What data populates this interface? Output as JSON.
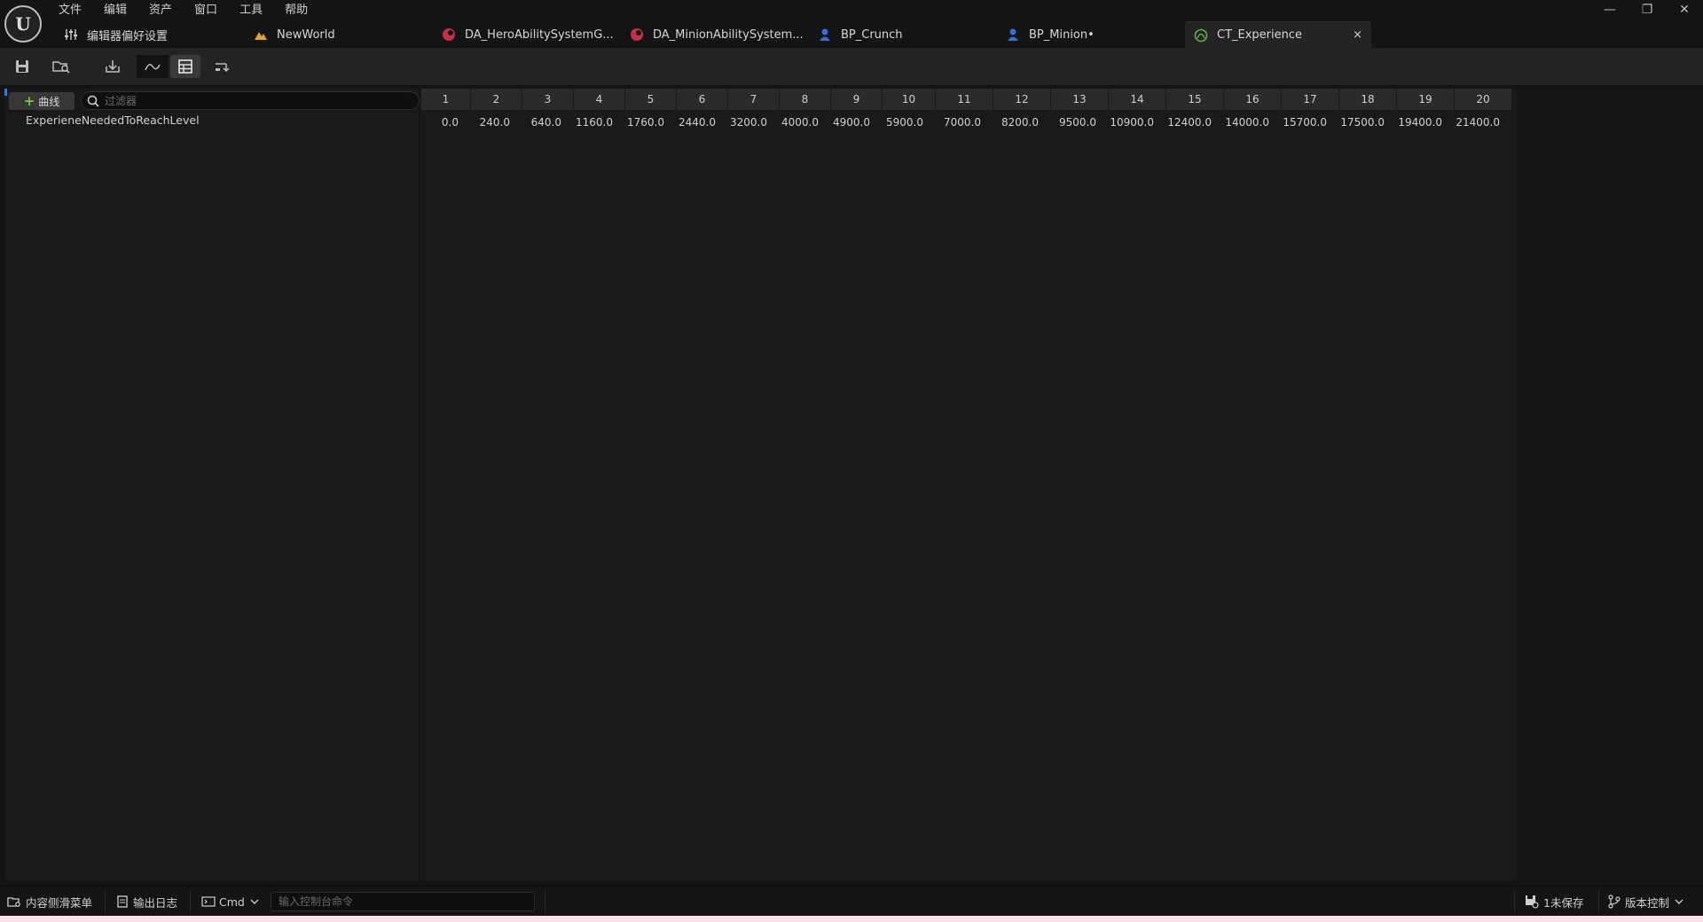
{
  "menubar": [
    "文件",
    "编辑",
    "资产",
    "窗口",
    "工具",
    "帮助"
  ],
  "logo_text": "U",
  "tabs": [
    {
      "label": "编辑器偏好设置",
      "icon": "sliders-icon"
    },
    {
      "label": "NewWorld",
      "icon": "level-icon"
    },
    {
      "label": "DA_HeroAbilitySystemG...",
      "icon": "data-asset-icon"
    },
    {
      "label": "DA_MinionAbilitySystem...",
      "icon": "data-asset-icon"
    },
    {
      "label": "BP_Crunch",
      "icon": "blueprint-character-icon"
    },
    {
      "label": "BP_Minion•",
      "icon": "blueprint-character-icon"
    },
    {
      "label": "CT_Experience",
      "icon": "curve-table-icon",
      "active": true
    }
  ],
  "tab_close_glyph": "×",
  "window_controls": {
    "minimize": "—",
    "restore": "❐",
    "close": "✕"
  },
  "curves_panel": {
    "add_button_label": "曲线",
    "filter_placeholder": "过滤器",
    "curve_name": "ExperieneNeededToReachLevel"
  },
  "table": {
    "columns": [
      "1",
      "2",
      "3",
      "4",
      "5",
      "6",
      "7",
      "8",
      "9",
      "10",
      "11",
      "12",
      "13",
      "14",
      "15",
      "16",
      "17",
      "18",
      "19",
      "20"
    ],
    "values": [
      "0.0",
      "240.0",
      "640.0",
      "1160.0",
      "1760.0",
      "2440.0",
      "3200.0",
      "4000.0",
      "4900.0",
      "5900.0",
      "7000.0",
      "8200.0",
      "9500.0",
      "10900.0",
      "12400.0",
      "14000.0",
      "15700.0",
      "17500.0",
      "19400.0",
      "21400.0"
    ]
  },
  "statusbar": {
    "content_drawer": "内容侧滑菜单",
    "output_log": "输出日志",
    "cmd": "Cmd",
    "console_placeholder": "输入控制台命令",
    "unsaved": "1未保存",
    "source_control": "版本控制"
  },
  "colors": {
    "accent_blue": "#2f7fd6",
    "add_plus_green": "#6fcf4e",
    "data_asset_red": "#c2304a",
    "blueprint_blue": "#3b6fd8",
    "level_orange": "#e0a030",
    "curve_table_green": "#5fae4e"
  }
}
